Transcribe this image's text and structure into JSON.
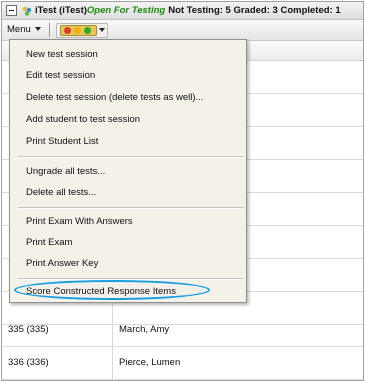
{
  "titlebar": {
    "title": "iTest (iTest)",
    "status": "Open For Testing",
    "counts": "Not Testing: 5 Graded: 3 Completed: 1",
    "icons": [
      "collapse-icon",
      "app-icon"
    ]
  },
  "toolbar": {
    "menu_label": "Menu",
    "lights_icon": "traffic-light-icon",
    "lights_colors": [
      "#e03a2a",
      "#f0b010",
      "#2fa52a"
    ]
  },
  "menu": {
    "group1": [
      "New test session",
      "Edit test session",
      "Delete test session (delete tests as well)...",
      "Add student to test session",
      "Print Student List"
    ],
    "group2": [
      "Ungrade all tests...",
      "Delete all tests..."
    ],
    "group3": [
      "Print Exam With Answers",
      "Print Exam",
      "Print Answer Key"
    ],
    "group4": [
      "Score Constructed Response Items"
    ],
    "highlight_color": "#1a9ee2"
  },
  "table": {
    "rows": [
      {
        "id": "335 (335)",
        "name": "March, Amy"
      },
      {
        "id": "336 (336)",
        "name": "Pierce, Lumen"
      }
    ]
  },
  "colors": {
    "status_green": "#1a8a12",
    "menu_bg": "#f3f1ea"
  }
}
